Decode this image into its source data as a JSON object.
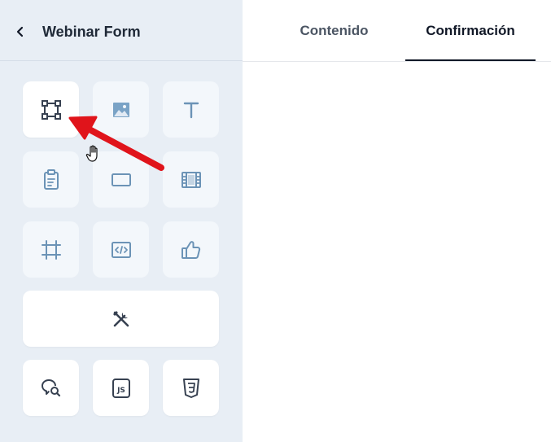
{
  "header": {
    "title": "Webinar Form",
    "back_icon": "chevron-left-icon"
  },
  "tabs": [
    {
      "label": "Contenido",
      "active": false
    },
    {
      "label": "Confirmación",
      "active": true
    }
  ],
  "widgets": [
    {
      "icon": "container-frame-icon",
      "highlighted": true
    },
    {
      "icon": "image-icon"
    },
    {
      "icon": "text-icon"
    },
    {
      "icon": "form-clipboard-icon"
    },
    {
      "icon": "button-rectangle-icon"
    },
    {
      "icon": "video-film-icon"
    },
    {
      "icon": "crop-frame-icon"
    },
    {
      "icon": "html-code-icon"
    },
    {
      "icon": "thumbs-up-icon"
    },
    {
      "icon": "tools-icon",
      "wide": true
    },
    {
      "icon": "search-chat-icon"
    },
    {
      "icon": "js-file-icon"
    },
    {
      "icon": "css3-icon"
    }
  ],
  "colors": {
    "sidebar_bg": "#e8eef5",
    "icon_muted": "#6b93b6",
    "icon_dark": "#374151",
    "annotation_arrow": "#e0141b"
  }
}
